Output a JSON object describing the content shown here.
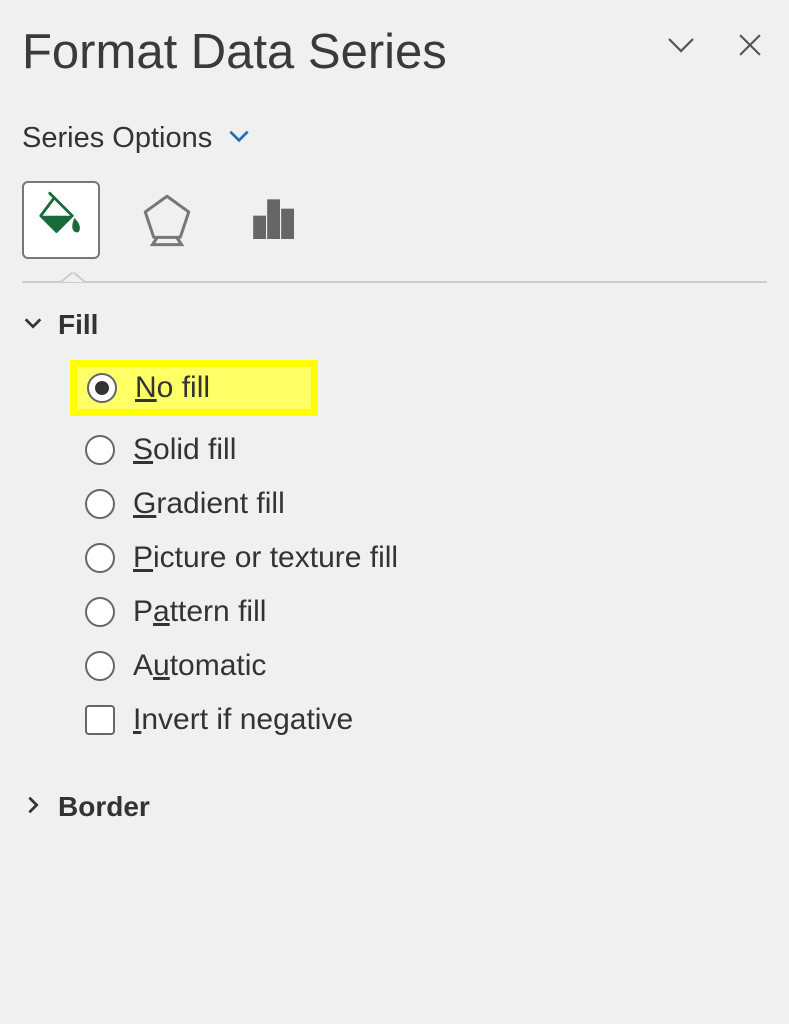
{
  "header": {
    "title": "Format Data Series"
  },
  "subhead": {
    "label": "Series Options"
  },
  "tabs": {
    "fill_icon": "paint-bucket",
    "effects_icon": "pentagon",
    "series_icon": "bar-chart"
  },
  "fill_section": {
    "title": "Fill",
    "expanded": true,
    "options": [
      {
        "label_pre": "",
        "u": "N",
        "label_post": "o fill",
        "selected": true
      },
      {
        "label_pre": "",
        "u": "S",
        "label_post": "olid fill",
        "selected": false
      },
      {
        "label_pre": "",
        "u": "G",
        "label_post": "radient fill",
        "selected": false
      },
      {
        "label_pre": "",
        "u": "P",
        "label_post": "icture or texture fill",
        "selected": false
      },
      {
        "label_pre": "P",
        "u": "a",
        "label_post": "ttern fill",
        "selected": false
      },
      {
        "label_pre": "A",
        "u": "u",
        "label_post": "tomatic",
        "selected": false
      }
    ],
    "invert": {
      "pre": "",
      "u": "I",
      "post": "nvert if negative"
    }
  },
  "border_section": {
    "title": "Border",
    "expanded": false
  }
}
